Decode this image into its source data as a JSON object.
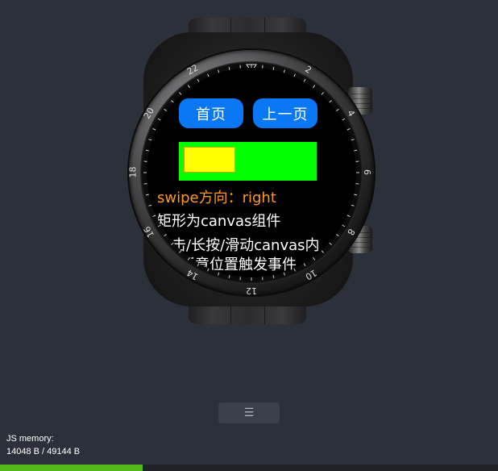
{
  "watch": {
    "buttons": {
      "home_label": "首页",
      "prev_label": "上一页"
    },
    "swipe_text": "swipe方向：right",
    "info_lines": [
      "矩形为canvas组件",
      "点击/长按/滑动canvas内",
      "任意位置触发事件"
    ],
    "bezel_numerals": [
      "2",
      "4",
      "6",
      "8",
      "10",
      "12",
      "14",
      "16",
      "18",
      "20",
      "22"
    ],
    "colors": {
      "button": "#0a78f5",
      "canvas_outer": "#00ff00",
      "canvas_inner": "#ffff00",
      "swipe_text": "#ff9a1f"
    }
  },
  "toolbar": {
    "menu_icon": "menu-icon",
    "memory_label": "JS memory:",
    "memory_value": "14048 B / 49144 B",
    "memory_used": 14048,
    "memory_total": 49144
  }
}
